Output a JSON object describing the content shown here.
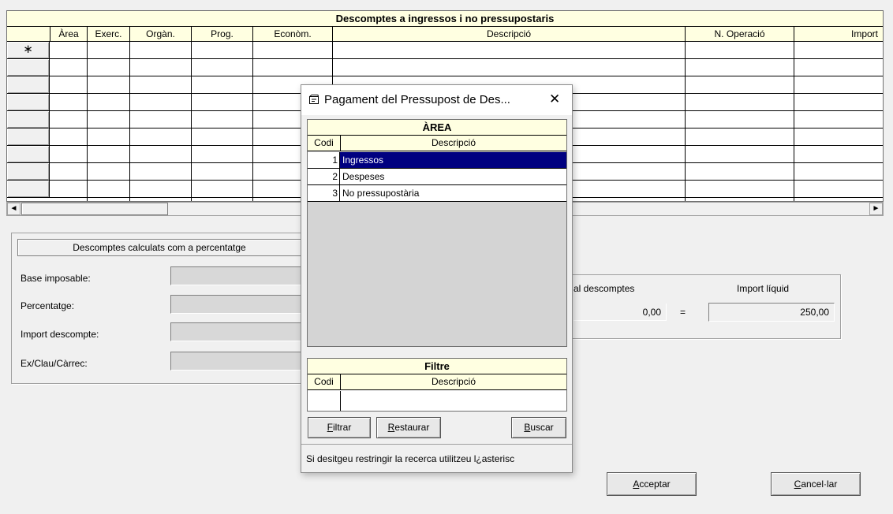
{
  "grid": {
    "title": "Descomptes a ingressos i no pressupostaris",
    "columns": [
      "Àrea",
      "Exerc.",
      "Orgàn.",
      "Prog.",
      "Econòm.",
      "Descripció",
      "N. Operació",
      "Import"
    ],
    "new_row_marker": "∗"
  },
  "scroll": {
    "left_arrow": "◄",
    "right_arrow": "►"
  },
  "percent_group": {
    "title": "Descomptes calculats com a percentatge",
    "base_label": "Base imposable:",
    "percent_label": "Percentatge:",
    "import_label": "Import descompte:",
    "key_label": "Ex/Clau/Càrrec:"
  },
  "totals": {
    "total_label": "al descomptes",
    "total_value": "0,00",
    "equals": "=",
    "net_label": "Import líquid",
    "net_value": "250,00"
  },
  "buttons": {
    "accept_u": "A",
    "accept_rest": "cceptar",
    "cancel_u": "C",
    "cancel_rest": "ancel·lar"
  },
  "dialog": {
    "title": "Pagament del Pressupost de Des...",
    "close": "✕",
    "area_header": "ÀREA",
    "col_code": "Codi",
    "col_desc": "Descripció",
    "rows": [
      {
        "code": "1",
        "desc": "Ingressos"
      },
      {
        "code": "2",
        "desc": "Despeses"
      },
      {
        "code": "3",
        "desc": "No pressupostària"
      }
    ],
    "filter_header": "Filtre",
    "filter_btn_u": "F",
    "filter_btn_rest": "iltrar",
    "restore_btn_u": "R",
    "restore_btn_rest": "estaurar",
    "search_btn_u": "B",
    "search_btn_rest": "uscar",
    "hint": "Si desitgeu restringir la recerca utilitzeu l¿asterisc"
  }
}
